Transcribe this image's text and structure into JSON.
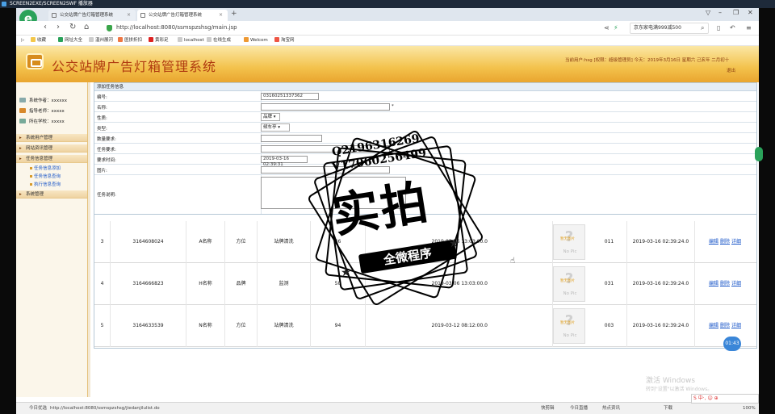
{
  "player": {
    "title": "SCREEN2EXE/SCREEN2SWF 播放器"
  },
  "browser": {
    "tabs": [
      {
        "label": "公交站牌广告灯箱管理系统",
        "active": false
      },
      {
        "label": "公交站牌广告灯箱管理系统",
        "active": true
      }
    ],
    "url": "http://localhost:8080/ssmspzshsg/main.jsp",
    "search_text": "京东家电满999减500",
    "bookmarks": [
      "收藏",
      "网址大全",
      "温州展河",
      "医拼折扣",
      "黄彩足",
      "localhost",
      "在线生成",
      "Welcom",
      "淘宝网"
    ]
  },
  "app": {
    "title": "公交站牌广告灯箱管理系统",
    "userinfo": "当前用户:hsg [权限：超级管理员] 今天：2019年3月16日 星期六 己亥年 二月初十",
    "logout": "退出"
  },
  "sidebar": {
    "info": [
      {
        "label": "系统作者：xxxxxx"
      },
      {
        "label": "指导老师：xxxxx"
      },
      {
        "label": "所在学校：xxxxx"
      }
    ],
    "menus": [
      {
        "label": "系统用户管理"
      },
      {
        "label": "网站资讯管理"
      },
      {
        "label": "任务信息管理"
      }
    ],
    "submenus": [
      "任务信息添加",
      "任务信息查询",
      "执行信息查询"
    ],
    "last_menu": "系统管理"
  },
  "form": {
    "title": "添加任务信息",
    "fields": [
      {
        "label": "编号:",
        "value": "03160251337362"
      },
      {
        "label": "名称:",
        "value": "",
        "required": "*"
      },
      {
        "label": "性质:",
        "value": "品牌"
      },
      {
        "label": "类型:",
        "value": "候车亭"
      },
      {
        "label": "数量要求:",
        "value": ""
      },
      {
        "label": "任务要求:",
        "value": ""
      },
      {
        "label": "要求时间:",
        "value": "2019-03-16 02:39:31"
      },
      {
        "label": "图片:",
        "value": ""
      },
      {
        "label": "任务说明:",
        "value": ""
      }
    ]
  },
  "table": {
    "rows": [
      {
        "idx": "3",
        "code": "3164608024",
        "name": "A名称",
        "nature": "方位",
        "type": "站牌清洗",
        "qty": "46",
        "start": "2019-03-06 13:03:00.0",
        "pic": "No Pic",
        "num": "011",
        "time": "2019-03-16 02:39:24.0",
        "actions": [
          "编辑",
          "删除",
          "详细"
        ]
      },
      {
        "idx": "4",
        "code": "3164666823",
        "name": "H名称",
        "nature": "品牌",
        "type": "监测",
        "qty": "50",
        "start": "2019-03-06 13:03:00.0",
        "pic": "No Pic",
        "num": "031",
        "time": "2019-03-16 02:39:24.0",
        "actions": [
          "编辑",
          "删除",
          "详细"
        ]
      },
      {
        "idx": "5",
        "code": "3164633539",
        "name": "N名称",
        "nature": "方位",
        "type": "站牌清洗",
        "qty": "94",
        "start": "2019-03-12 08:12:00.0",
        "pic": "No Pic",
        "num": "003",
        "time": "2019-03-16 02:39:24.0",
        "actions": [
          "编辑",
          "删除",
          "详细"
        ]
      }
    ],
    "pic_badge": "暂无图片"
  },
  "status": {
    "left": "今日优选",
    "url": "http://localhost:8080/ssmspzshsg/jiedanjilulist.do",
    "right_items": [
      "快剪辑",
      "今日直播",
      "热点资讯",
      "下载",
      "100%"
    ]
  },
  "overlay": {
    "contact1": "Q2196316269",
    "contact2": "V17060256499",
    "big": "实拍",
    "banner": "全微程序",
    "windows1": "激活 Windows",
    "windows2": "转到\"设置\"以激活 Windows。",
    "timer": "01:43",
    "ime": "S 中·, ☺ ⊕"
  },
  "colors": {
    "accent": "#1a56c8",
    "header": "#f3c24c",
    "title": "#b03a10"
  }
}
